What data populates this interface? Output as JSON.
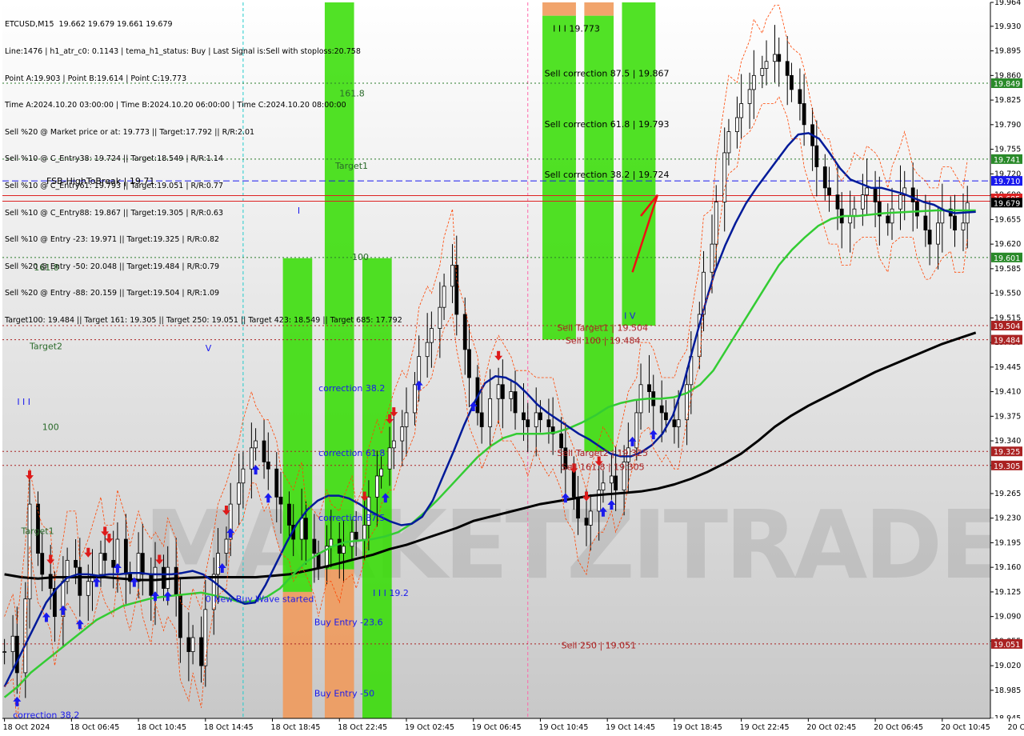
{
  "header": {
    "symbol_line": "ETCUSD,M15  19.662 19.679 19.661 19.679",
    "lines": [
      "Line:1476 | h1_atr_c0: 0.1143 | tema_h1_status: Buy | Last Signal is:Sell with stoploss:20.758",
      "Point A:19.903 | Point B:19.614 | Point C:19.773",
      "Time A:2024.10.20 03:00:00 | Time B:2024.10.20 06:00:00 | Time C:2024.10.20 08:00:00",
      "Sell %20 @ Market price or at: 19.773 || Target:17.792 || R/R:2.01",
      "Sell %10 @ C_Entry38: 19.724 || Target:18.549 | R/R:1.14",
      "Sell %10 @ C_Entry61: 19.793 || Target:19.051 | R/R:0.77",
      "Sell %10 @ C_Entry88: 19.867 || Target:19.305 | R/R:0.63",
      "Sell %10 @ Entry -23: 19.971 || Target:19.325 | R/R:0.82",
      "Sell %20 @ Entry -50: 20.048 || Target:19.484 | R/R:0.79",
      "Sell %20 @ Entry -88: 20.159 || Target:19.504 | R/R:1.09",
      "Target100: 19.484 || Target 161: 19.305 || Target 250: 19.051 || Target 423: 18.549 || Target 685: 17.792"
    ]
  },
  "watermark": "MARKETZITRADE",
  "colors": {
    "green_zone": "#33dd00",
    "orange_zone": "#f09a5c",
    "fast_ma": "#001a99",
    "mid_ma": "#33cc33",
    "slow_ma": "#000000",
    "envelope": "#ff4400",
    "dark_red": "#aa2222",
    "dark_green": "#2a7a2a",
    "blue_line": "#1a1aee"
  },
  "chart_data": {
    "type": "candlestick",
    "symbol": "ETCUSD",
    "timeframe": "M15",
    "ylim": [
      18.945,
      19.964
    ],
    "y_ticks": [
      "19.964",
      "19.930",
      "19.895",
      "19.860",
      "19.825",
      "19.790",
      "19.755",
      "19.720",
      "19.690",
      "19.655",
      "19.620",
      "19.585",
      "19.550",
      "19.515",
      "19.480",
      "19.445",
      "19.410",
      "19.375",
      "19.340",
      "19.305",
      "19.265",
      "19.230",
      "19.195",
      "19.160",
      "19.125",
      "19.090",
      "19.055",
      "19.020",
      "18.985",
      "18.945"
    ],
    "x_ticks": [
      "18 Oct 2024",
      "18 Oct 06:45",
      "18 Oct 10:45",
      "18 Oct 14:45",
      "18 Oct 18:45",
      "18 Oct 22:45",
      "19 Oct 02:45",
      "19 Oct 06:45",
      "19 Oct 10:45",
      "19 Oct 14:45",
      "19 Oct 18:45",
      "19 Oct 22:45",
      "20 Oct 02:45",
      "20 Oct 06:45",
      "20 Oct 10:45",
      "20 Oct 14:45"
    ],
    "bar_count": 236,
    "x_tick_every": 16,
    "price_badges": [
      {
        "label": "19.849",
        "value": 19.849,
        "color": "#2a8a2a"
      },
      {
        "label": "19.741",
        "value": 19.741,
        "color": "#2a8a2a"
      },
      {
        "label": "19.710",
        "value": 19.71,
        "color": "#1a1aee"
      },
      {
        "label": "19.685",
        "value": 19.685,
        "color": "#dd2222"
      },
      {
        "label": "19.679",
        "value": 19.679,
        "color": "#000000"
      },
      {
        "label": "19.601",
        "value": 19.601,
        "color": "#2a8a2a"
      },
      {
        "label": "19.504",
        "value": 19.504,
        "color": "#aa2222"
      },
      {
        "label": "19.484",
        "value": 19.484,
        "color": "#aa2222"
      },
      {
        "label": "19.325",
        "value": 19.325,
        "color": "#aa2222"
      },
      {
        "label": "19.305",
        "value": 19.305,
        "color": "#aa2222"
      },
      {
        "label": "19.051",
        "value": 19.051,
        "color": "#aa2222"
      }
    ],
    "h_lines": [
      {
        "value": 19.849,
        "color": "#2a7a2a",
        "style": "dotted"
      },
      {
        "value": 19.741,
        "color": "#2a7a2a",
        "style": "dotted"
      },
      {
        "value": 19.71,
        "color": "#1a1aee",
        "style": "dashed"
      },
      {
        "value": 19.689,
        "color": "#dd2222",
        "style": "solid"
      },
      {
        "value": 19.681,
        "color": "#dd2222",
        "style": "solid"
      },
      {
        "value": 19.601,
        "color": "#2a7a2a",
        "style": "dotted"
      },
      {
        "value": 19.504,
        "color": "#aa2222",
        "style": "dotted"
      },
      {
        "value": 19.484,
        "color": "#aa2222",
        "style": "dotted"
      },
      {
        "value": 19.325,
        "color": "#aa2222",
        "style": "dotted"
      },
      {
        "value": 19.305,
        "color": "#aa2222",
        "style": "dotted"
      },
      {
        "value": 19.051,
        "color": "#aa2222",
        "style": "dotted"
      }
    ],
    "v_lines": [
      {
        "bar": 57,
        "color": "#22cccc"
      },
      {
        "bar": 125,
        "color": "#ff66aa"
      }
    ],
    "zones": [
      {
        "from_bar": 67,
        "to_bar": 73,
        "top": 19.6,
        "bottom": 19.125,
        "color": "green"
      },
      {
        "from_bar": 67,
        "to_bar": 73,
        "top": 19.125,
        "bottom": 18.945,
        "color": "orange"
      },
      {
        "from_bar": 77,
        "to_bar": 83,
        "top": 19.964,
        "bottom": 19.157,
        "color": "green"
      },
      {
        "from_bar": 77,
        "to_bar": 83,
        "top": 19.157,
        "bottom": 18.945,
        "color": "orange"
      },
      {
        "from_bar": 86,
        "to_bar": 92,
        "top": 19.6,
        "bottom": 18.945,
        "color": "green"
      },
      {
        "from_bar": 129,
        "to_bar": 136,
        "top": 19.964,
        "bottom": 19.945,
        "color": "orange"
      },
      {
        "from_bar": 129,
        "to_bar": 136,
        "top": 19.945,
        "bottom": 19.484,
        "color": "green"
      },
      {
        "from_bar": 139,
        "to_bar": 145,
        "top": 19.964,
        "bottom": 19.945,
        "color": "orange"
      },
      {
        "from_bar": 139,
        "to_bar": 145,
        "top": 19.945,
        "bottom": 19.325,
        "color": "green"
      },
      {
        "from_bar": 148,
        "to_bar": 155,
        "top": 19.964,
        "bottom": 19.504,
        "color": "green"
      }
    ],
    "labels": [
      {
        "text": "FSB-HighToBreak  |  19.71",
        "bar": 10,
        "value": 19.71,
        "color": "#000"
      },
      {
        "text": "161.8",
        "bar": 7,
        "value": 19.587,
        "color": "#2a6a2a"
      },
      {
        "text": "Target2",
        "bar": 6,
        "value": 19.475,
        "color": "#2a6a2a"
      },
      {
        "text": "I I I",
        "bar": 3,
        "value": 19.396,
        "color": "#1a1aee"
      },
      {
        "text": "100",
        "bar": 9,
        "value": 19.36,
        "color": "#2a6a2a"
      },
      {
        "text": "Target1",
        "bar": 4,
        "value": 19.212,
        "color": "#2a6a2a"
      },
      {
        "text": "161.8",
        "bar": 80,
        "value": 19.835,
        "color": "#2a6a2a"
      },
      {
        "text": "Target1",
        "bar": 79,
        "value": 19.732,
        "color": "#2a6a2a"
      },
      {
        "text": "100",
        "bar": 83,
        "value": 19.602,
        "color": "#2a6a2a"
      },
      {
        "text": "I",
        "bar": 70,
        "value": 19.668,
        "color": "#1a1aee"
      },
      {
        "text": "V",
        "bar": 48,
        "value": 19.472,
        "color": "#1a1aee"
      },
      {
        "text": "correction 38.2",
        "bar": 75,
        "value": 19.415,
        "color": "#1a1aee"
      },
      {
        "text": "correction 61.8",
        "bar": 75,
        "value": 19.323,
        "color": "#1a1aee"
      },
      {
        "text": "correction 87.5",
        "bar": 75,
        "value": 19.231,
        "color": "#1a1aee"
      },
      {
        "text": "0 New Buy Wave started",
        "bar": 48,
        "value": 19.115,
        "color": "#1a1aee"
      },
      {
        "text": "Buy Entry -23.6",
        "bar": 74,
        "value": 19.082,
        "color": "#1a1aee"
      },
      {
        "text": "Buy Entry -50",
        "bar": 74,
        "value": 18.981,
        "color": "#1a1aee"
      },
      {
        "text": "I I I  19.2",
        "bar": 88,
        "value": 19.124,
        "color": "#1a1aee"
      },
      {
        "text": "correction 38.2",
        "bar": 2,
        "value": 18.95,
        "color": "#1a1aee"
      },
      {
        "text": "I I I  19.773",
        "bar": 131,
        "value": 19.927,
        "color": "#000"
      },
      {
        "text": "Sell correction 87.5 | 19.867",
        "bar": 129,
        "value": 19.863,
        "color": "#000"
      },
      {
        "text": "Sell correction 61.8 | 19.793",
        "bar": 129,
        "value": 19.791,
        "color": "#000"
      },
      {
        "text": "Sell correction 38.2 | 19.724",
        "bar": 129,
        "value": 19.719,
        "color": "#000"
      },
      {
        "text": "Sell Target1 | 19.504",
        "bar": 132,
        "value": 19.501,
        "color": "#aa2222"
      },
      {
        "text": "Sell 100 | 19.484",
        "bar": 134,
        "value": 19.483,
        "color": "#aa2222"
      },
      {
        "text": "Sell Target2 | 19.325",
        "bar": 132,
        "value": 19.323,
        "color": "#aa2222"
      },
      {
        "text": "Sell 161.8 | 19.305",
        "bar": 133,
        "value": 19.303,
        "color": "#aa2222"
      },
      {
        "text": "Sell  250 | 19.051",
        "bar": 133,
        "value": 19.049,
        "color": "#aa2222"
      },
      {
        "text": "I V",
        "bar": 148,
        "value": 19.518,
        "color": "#1a1aee"
      }
    ],
    "series": [
      {
        "name": "close",
        "values": [
          19.04,
          19.062,
          19.01,
          19.115,
          19.25,
          19.18,
          19.15,
          19.13,
          19.09,
          19.14,
          19.17,
          19.16,
          19.12,
          19.14,
          19.15,
          19.18,
          19.17,
          19.16,
          19.2,
          19.15,
          19.14,
          19.18,
          19.15,
          19.12,
          19.16,
          19.13,
          19.16,
          19.12,
          19.06,
          19.04,
          19.06,
          19.02,
          19.1,
          19.15,
          19.18,
          19.2,
          19.25,
          19.28,
          19.3,
          19.33,
          19.34,
          19.31,
          19.3,
          19.26,
          19.25,
          19.22,
          19.2,
          19.23,
          19.2,
          19.18,
          19.16,
          19.19,
          19.2,
          19.18,
          19.19,
          19.21,
          19.2,
          19.22,
          19.26,
          19.29,
          19.3,
          19.33,
          19.34,
          19.36,
          19.38,
          19.42,
          19.46,
          19.48,
          19.5,
          19.53,
          19.56,
          19.59,
          19.52,
          19.47,
          19.43,
          19.38,
          19.36,
          19.4,
          19.42,
          19.4,
          19.41,
          19.38,
          19.37,
          19.36,
          19.38,
          19.37,
          19.36,
          19.35,
          19.33,
          19.3,
          19.26,
          19.23,
          19.22,
          19.24,
          19.27,
          19.28,
          19.29,
          19.27,
          19.31,
          19.33,
          19.38,
          19.42,
          19.41,
          19.39,
          19.38,
          19.37,
          19.36,
          19.37,
          19.42,
          19.46,
          19.52,
          19.58,
          19.62,
          19.68,
          19.75,
          19.78,
          19.8,
          19.82,
          19.84,
          19.86,
          19.87,
          19.88,
          19.89,
          19.88,
          19.86,
          19.84,
          19.82,
          19.79,
          19.76,
          19.73,
          19.7,
          19.69,
          19.67,
          19.65,
          19.66,
          19.67,
          19.69,
          19.7,
          19.68,
          19.66,
          19.65,
          19.67,
          19.69,
          19.7,
          19.68,
          19.66,
          19.64,
          19.62,
          19.65,
          19.67,
          19.66,
          19.64,
          19.65,
          19.679
        ]
      },
      {
        "name": "fast_ma",
        "values": [
          18.99,
          19.02,
          19.05,
          19.08,
          19.11,
          19.13,
          19.145,
          19.15,
          19.15,
          19.148,
          19.15,
          19.15,
          19.152,
          19.152,
          19.15,
          19.15,
          19.15,
          19.152,
          19.155,
          19.15,
          19.14,
          19.128,
          19.115,
          19.108,
          19.11,
          19.135,
          19.165,
          19.195,
          19.222,
          19.242,
          19.255,
          19.262,
          19.262,
          19.258,
          19.25,
          19.24,
          19.232,
          19.225,
          19.22,
          19.222,
          19.232,
          19.255,
          19.29,
          19.325,
          19.362,
          19.395,
          19.422,
          19.432,
          19.43,
          19.422,
          19.408,
          19.392,
          19.38,
          19.37,
          19.36,
          19.35,
          19.342,
          19.332,
          19.322,
          19.318,
          19.318,
          19.324,
          19.334,
          19.35,
          19.376,
          19.42,
          19.476,
          19.53,
          19.58,
          19.618,
          19.65,
          19.678,
          19.7,
          19.72,
          19.74,
          19.76,
          19.776,
          19.778,
          19.77,
          19.75,
          19.728,
          19.712,
          19.706,
          19.7,
          19.7,
          19.696,
          19.692,
          19.686,
          19.68,
          19.676,
          19.668,
          19.664,
          19.665,
          19.666
        ]
      },
      {
        "name": "mid_ma",
        "values": [
          18.975,
          18.99,
          19.01,
          19.025,
          19.04,
          19.055,
          19.07,
          19.085,
          19.095,
          19.105,
          19.11,
          19.115,
          19.118,
          19.12,
          19.122,
          19.124,
          19.12,
          19.116,
          19.11,
          19.112,
          19.118,
          19.13,
          19.15,
          19.168,
          19.18,
          19.19,
          19.196,
          19.198,
          19.2,
          19.204,
          19.21,
          19.222,
          19.238,
          19.256,
          19.276,
          19.296,
          19.316,
          19.332,
          19.344,
          19.35,
          19.35,
          19.35,
          19.352,
          19.358,
          19.366,
          19.376,
          19.388,
          19.394,
          19.398,
          19.4,
          19.4,
          19.402,
          19.408,
          19.42,
          19.44,
          19.47,
          19.5,
          19.53,
          19.56,
          19.59,
          19.612,
          19.63,
          19.646,
          19.656,
          19.66,
          19.66,
          19.662,
          19.664,
          19.665,
          19.666,
          19.667,
          19.668,
          19.668,
          19.668,
          19.668
        ]
      },
      {
        "name": "slow_ma",
        "values": [
          19.15,
          19.146,
          19.144,
          19.146,
          19.146,
          19.146,
          19.146,
          19.144,
          19.142,
          19.142,
          19.144,
          19.145,
          19.146,
          19.146,
          19.146,
          19.146,
          19.148,
          19.15,
          19.155,
          19.16,
          19.166,
          19.172,
          19.178,
          19.186,
          19.192,
          19.2,
          19.208,
          19.216,
          19.226,
          19.232,
          19.238,
          19.244,
          19.25,
          19.254,
          19.258,
          19.262,
          19.264,
          19.266,
          19.268,
          19.272,
          19.278,
          19.286,
          19.296,
          19.308,
          19.322,
          19.34,
          19.36,
          19.376,
          19.39,
          19.402,
          19.414,
          19.426,
          19.438,
          19.448,
          19.458,
          19.468,
          19.478,
          19.486,
          19.494
        ]
      }
    ],
    "buy_arrow_bars": [
      3,
      10,
      14,
      18,
      22,
      27,
      31,
      36,
      39,
      52,
      54,
      60,
      63,
      91,
      99,
      112,
      134,
      143,
      145,
      150,
      155
    ],
    "sell_arrow_bars": [
      6,
      11,
      20,
      24,
      25,
      37,
      53,
      86,
      92,
      93,
      118,
      136,
      139,
      142
    ],
    "close_marker": {
      "bar": 158,
      "value": 19.679
    }
  }
}
